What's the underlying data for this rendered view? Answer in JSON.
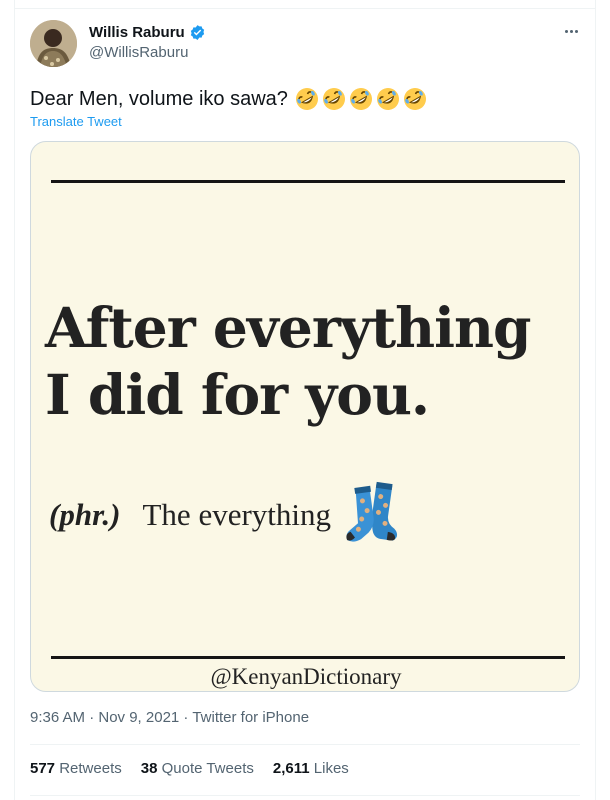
{
  "tweet": {
    "display_name": "Willis Raburu",
    "handle": "@WillisRaburu",
    "text": "Dear Men, volume iko sawa?",
    "emoji": [
      "rolling-on-floor-laughing",
      "rolling-on-floor-laughing",
      "rolling-on-floor-laughing",
      "rolling-on-floor-laughing",
      "rolling-on-floor-laughing"
    ],
    "translate_label": "Translate Tweet",
    "timestamp": "9:36 AM · Nov 9, 2021",
    "separator": " · ",
    "source": "Twitter for iPhone"
  },
  "media": {
    "headline_line1": "After everything",
    "headline_line2": "I did for you.",
    "part_of_speech": "(phr.)",
    "definition": "The everything",
    "definition_icon": "socks-icon",
    "watermark": "@KenyanDictionary",
    "background_color": "#fbf8e6"
  },
  "stats": {
    "retweets_count": "577",
    "retweets_label": "Retweets",
    "quotes_count": "38",
    "quotes_label": "Quote Tweets",
    "likes_count": "2,611",
    "likes_label": "Likes"
  },
  "colors": {
    "accent": "#1d9bf0",
    "secondary_text": "#536471",
    "primary_text": "#0f1419"
  }
}
